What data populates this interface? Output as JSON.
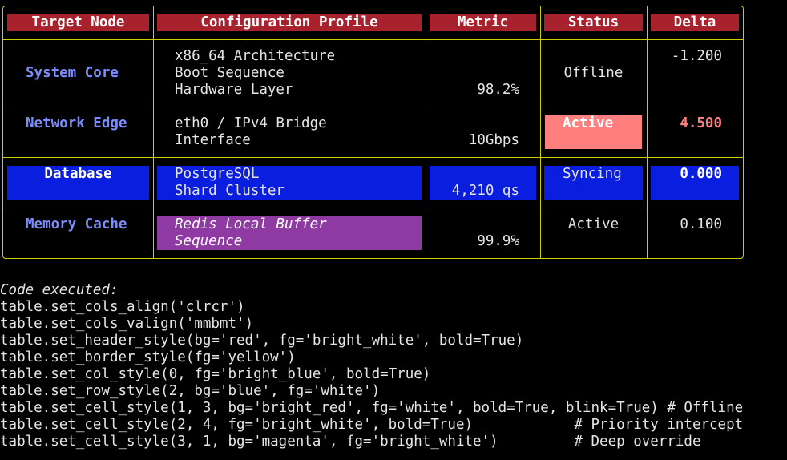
{
  "table": {
    "headers": [
      "Target Node",
      "Configuration Profile",
      "Metric",
      "Status",
      "Delta"
    ],
    "rows": [
      {
        "node": "System Core",
        "profile": [
          "x86_64 Architecture",
          "Boot Sequence",
          "Hardware Layer"
        ],
        "metric": "98.2%",
        "status": "Offline",
        "delta": "-1.200"
      },
      {
        "node": "Network Edge",
        "profile": [
          "eth0 / IPv4 Bridge",
          "Interface"
        ],
        "metric": "10Gbps",
        "status": "Active",
        "delta": "4.500"
      },
      {
        "node": "Database",
        "profile": [
          "PostgreSQL",
          "Shard Cluster"
        ],
        "metric": "4,210 qs",
        "status": "Syncing",
        "delta": "0.000"
      },
      {
        "node": "Memory Cache",
        "profile": [
          "Redis Local Buffer",
          "Sequence"
        ],
        "metric": "99.9%",
        "status": "Active",
        "delta": "0.100"
      }
    ]
  },
  "code": {
    "title": "Code executed:",
    "lines": [
      "table.set_cols_align('clrcr')",
      "table.set_cols_valign('mmbmt')",
      "table.set_header_style(bg='red', fg='bright_white', bold=True)",
      "table.set_border_style(fg='yellow')",
      "table.set_col_style(0, fg='bright_blue', bold=True)",
      "table.set_row_style(2, bg='blue', fg='white')",
      "table.set_cell_style(1, 3, bg='bright_red', fg='white', bold=True, blink=True) # Offline",
      "table.set_cell_style(2, 4, fg='bright_white', bold=True)            # Priority intercept",
      "table.set_cell_style(3, 1, bg='magenta', fg='bright_white')         # Deep override"
    ]
  },
  "colors": {
    "border": "#cdcd00",
    "header_bg": "#a8222d",
    "bright_blue": "#7b8cff",
    "blue_bg": "#0a1ee0",
    "bright_red_bg": "#ff7f7f",
    "bright_red_fg": "#ff7f7f",
    "magenta_bg": "#8e3aa2"
  }
}
